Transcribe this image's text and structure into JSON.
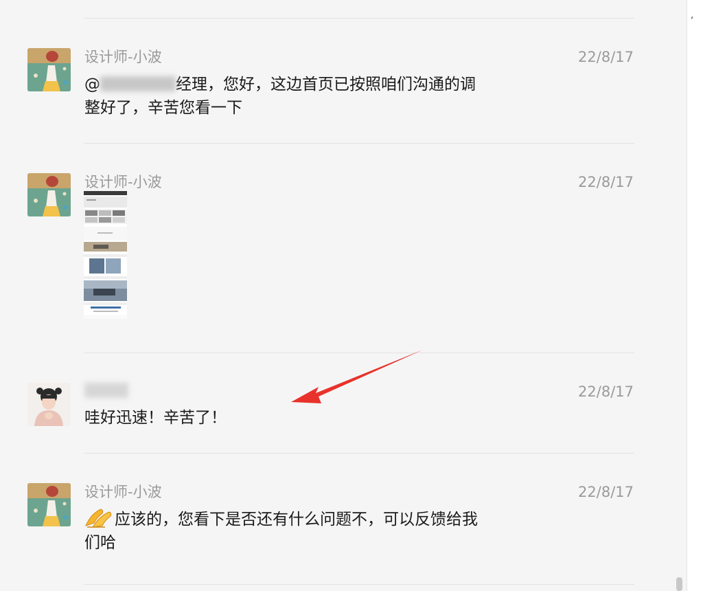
{
  "messages": [
    {
      "sender": "设计师-小波",
      "time": "22/8/17",
      "line1_prefix": "@",
      "line1_suffix": "经理，您好，这边首页已按照咱们沟通的调",
      "line2": "整好了，辛苦您看一下"
    },
    {
      "sender": "设计师-小波",
      "time": "22/8/17"
    },
    {
      "sender": "",
      "time": "22/8/17",
      "line1": "哇好迅速！辛苦了！"
    },
    {
      "sender": "设计师-小波",
      "time": "22/8/17",
      "line1": "应该的，您看下是否还有什么问题不，可以反馈给我",
      "line2": "们哈"
    }
  ],
  "icons": {
    "designer_avatar": "designer-avatar",
    "client_avatar": "client-avatar",
    "hands_emoji": "folded-hands-emoji",
    "arrow": "red-annotation-arrow"
  },
  "colors": {
    "background": "#f5f5f5",
    "meta_text": "#9a9a9a",
    "body_text": "#1a1a1a",
    "arrow": "#e8322b"
  }
}
